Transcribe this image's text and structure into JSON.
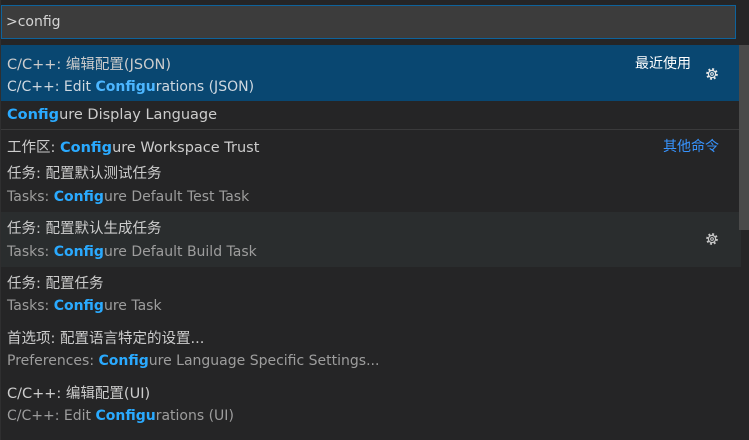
{
  "search": {
    "query": ">config"
  },
  "items": [
    {
      "label_pre": "C/C++: 编辑配置(JSON)",
      "detail_pre": "C/C++: Edit ",
      "detail_hl": "Configu",
      "detail_post": "rations (JSON)",
      "group": "最近使用"
    },
    {
      "label_hl": "Config",
      "label_post": "ure Display Language"
    },
    {
      "label_pre": "工作区: ",
      "label_hl": "Config",
      "label_post": "ure Workspace Trust",
      "group": "其他命令"
    },
    {
      "label_pre": "任务: 配置默认测试任务",
      "detail_pre": "Tasks: ",
      "detail_hl": "Config",
      "detail_post": "ure Default Test Task"
    },
    {
      "label_pre": "任务: 配置默认生成任务",
      "detail_pre": "Tasks: ",
      "detail_hl": "Config",
      "detail_post": "ure Default Build Task"
    },
    {
      "label_pre": "任务: 配置任务",
      "detail_pre": "Tasks: ",
      "detail_hl": "Config",
      "detail_post": "ure Task"
    },
    {
      "label_pre": "首选项: 配置语言特定的设置...",
      "detail_pre": "Preferences: ",
      "detail_hl": "Config",
      "detail_post": "ure Language Specific Settings..."
    },
    {
      "label_pre": "C/C++: 编辑配置(UI)",
      "detail_pre": "C/C++: Edit ",
      "detail_hl": "Configu",
      "detail_post": "rations (UI)"
    }
  ],
  "icons": {
    "gear": "gear-icon"
  },
  "colors": {
    "accent": "#2aaaff",
    "selection": "#094771",
    "border_focus": "#0e639c",
    "link": "#3794ff"
  }
}
